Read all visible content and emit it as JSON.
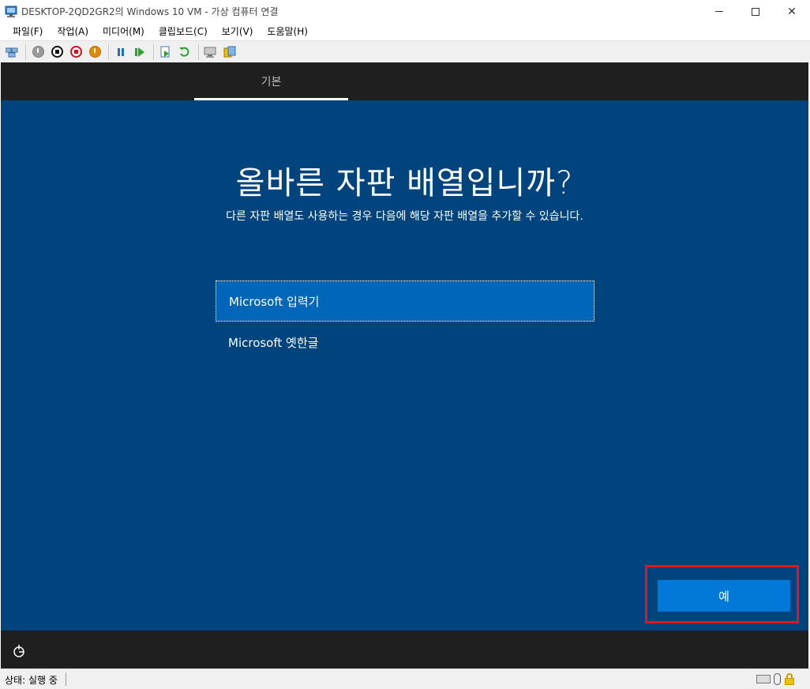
{
  "window": {
    "title": "DESKTOP-2QD2GR2의 Windows 10 VM - 가상 컴퓨터 연결",
    "minimize_glyph": "",
    "close_glyph": "✕"
  },
  "menu": {
    "items": [
      {
        "label": "파일(F)"
      },
      {
        "label": "작업(A)"
      },
      {
        "label": "미디어(M)"
      },
      {
        "label": "클립보드(C)"
      },
      {
        "label": "보기(V)"
      },
      {
        "label": "도움말(H)"
      }
    ]
  },
  "toolbar": {
    "icons": [
      "ctrl-alt-del-icon",
      "start-icon",
      "turn-off-icon",
      "shutdown-icon",
      "save-icon",
      "pause-icon",
      "resume-icon",
      "checkpoint-icon",
      "revert-icon",
      "enhanced-session-icon",
      "share-icon"
    ]
  },
  "vm": {
    "tab_label": "기본",
    "heading": "올바른 자판 배열입니까?",
    "subheading": "다른 자판 배열도 사용하는 경우 다음에 해당 자판 배열을 추가할 수 있습니다.",
    "layouts": [
      {
        "label": "Microsoft 입력기",
        "selected": true
      },
      {
        "label": "Microsoft 옛한글",
        "selected": false
      }
    ],
    "yes_button": "예",
    "accent_color": "#00447e",
    "highlight_color": "#e3141b"
  },
  "status": {
    "text": "상태: 실행 중"
  }
}
